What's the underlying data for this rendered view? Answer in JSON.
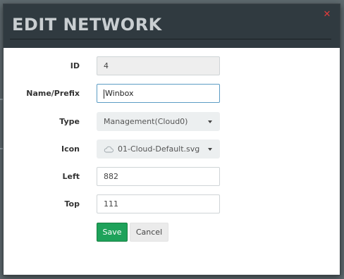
{
  "dialog": {
    "title": "EDIT NETWORK",
    "close_icon": "close-icon"
  },
  "form": {
    "id": {
      "label": "ID",
      "value": "4"
    },
    "name": {
      "label": "Name/Prefix",
      "value": "Winbox"
    },
    "type": {
      "label": "Type",
      "value": "Management(Cloud0)"
    },
    "icon": {
      "label": "Icon",
      "value": "01-Cloud-Default.svg",
      "icon": "cloud-icon"
    },
    "left": {
      "label": "Left",
      "value": "882"
    },
    "top": {
      "label": "Top",
      "value": "111"
    }
  },
  "buttons": {
    "save": "Save",
    "cancel": "Cancel"
  },
  "colors": {
    "header_bg": "#303a40",
    "save_bg": "#1ea25a",
    "close": "#e23b3b"
  }
}
